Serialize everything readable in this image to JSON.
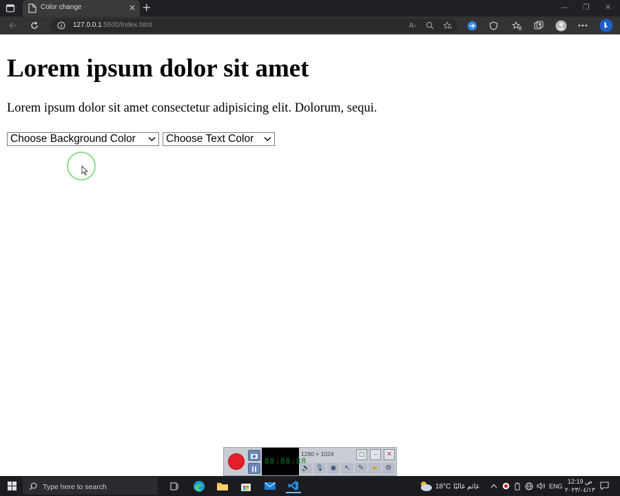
{
  "browser": {
    "tab_title": "Color change",
    "tab_close": "×",
    "new_tab": "+",
    "window_controls": {
      "minimize": "—",
      "maximize": "❐",
      "close": "✕"
    },
    "url_host": "127.0.0.1",
    "url_path": ":5500/index.html",
    "nav_icons": [
      "back-icon",
      "reload-icon",
      "info-icon"
    ],
    "toolbar_icons": [
      "read-aloud-icon",
      "zoom-icon",
      "favorite-add-icon",
      "extension-icon",
      "browser-essentials-icon",
      "favorites-icon",
      "collections-icon",
      "profile-icon",
      "more-icon",
      "bing-icon"
    ],
    "accent_color": "#2f8ff0"
  },
  "page": {
    "heading": "Lorem ipsum dolor sit amet",
    "paragraph": "Lorem ipsum dolor sit amet consectetur adipisicing elit. Dolorum, sequi.",
    "background_select": {
      "selected": "Choose Background Color"
    },
    "text_select": {
      "selected": "Choose Text Color"
    }
  },
  "recorder": {
    "digits": "88:88:88",
    "resolution": "1280 × 1024",
    "record_color": "#e61e2a"
  },
  "taskbar": {
    "search_placeholder": "Type here to search",
    "weather": "18°C",
    "weather_label": "غائم غالبًا",
    "language": "ENG",
    "time": "12:19 ص",
    "date": "٢٠٢٣/٠٤/١٣"
  }
}
